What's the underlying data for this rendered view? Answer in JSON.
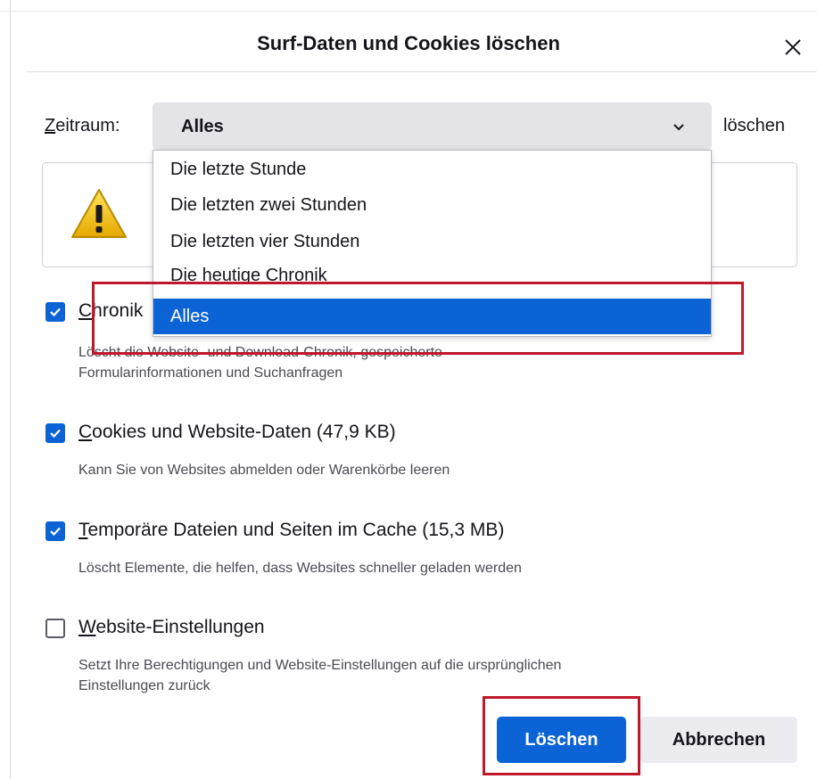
{
  "dialog": {
    "title": "Surf-Daten und Cookies löschen"
  },
  "timerange": {
    "label_prefix": "Z",
    "label_rest": "eitraum:",
    "selected": "Alles",
    "suffix": "löschen",
    "options": [
      "Die letzte Stunde",
      "Die letzten zwei Stunden",
      "Die letzten vier Stunden",
      "Die heutige Chronik",
      "Alles"
    ]
  },
  "options": [
    {
      "key": "C",
      "rest": "hronik",
      "desc1": "Löscht die Website- und Download-Chronik, gespeicherte",
      "desc2": "Formularinformationen und Suchanfragen",
      "checked": true
    },
    {
      "key": "C",
      "rest": "ookies und Website-Daten (47,9 KB)",
      "desc1": "Kann Sie von Websites abmelden oder Warenkörbe leeren",
      "checked": true
    },
    {
      "key": "T",
      "rest": "emporäre Dateien und Seiten im Cache (15,3 MB)",
      "desc1": "Löscht Elemente, die helfen, dass Websites schneller geladen werden",
      "checked": true
    },
    {
      "key": "W",
      "rest": "ebsite-Einstellungen",
      "desc1": "Setzt Ihre Berechtigungen und Website-Einstellungen auf die ursprünglichen",
      "desc2": "Einstellungen zurück",
      "checked": false
    }
  ],
  "buttons": {
    "primary": "Löschen",
    "secondary": "Abbrechen"
  },
  "icons": {
    "close": "close-icon",
    "chevron": "chevron-down-icon",
    "warning": "warning-icon",
    "check": "checkmark-icon"
  },
  "colors": {
    "accent": "#0b63d6",
    "highlight": "#c0182b",
    "warning": "#f2c200"
  }
}
